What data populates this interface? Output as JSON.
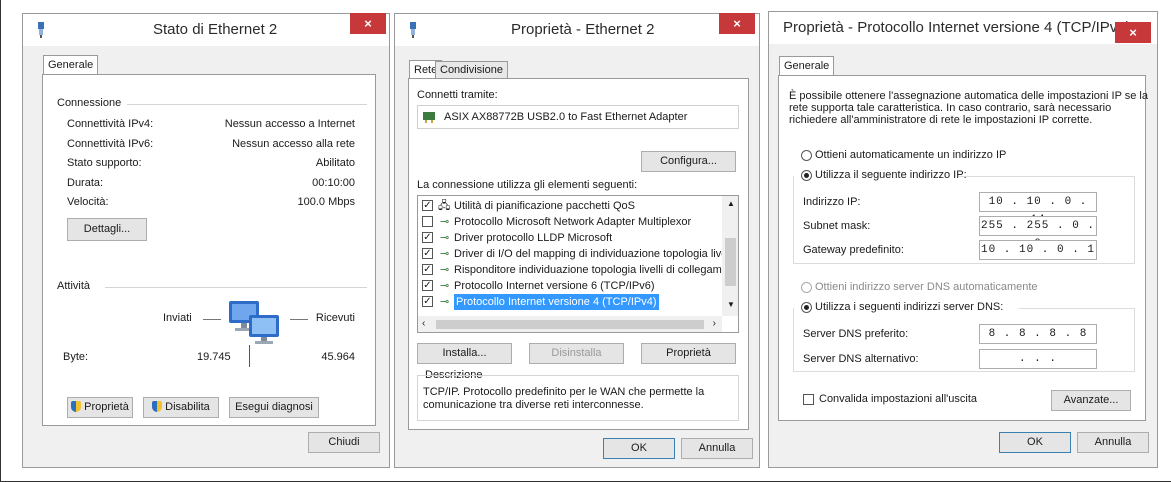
{
  "win1": {
    "title": "Stato di Ethernet 2",
    "close": "×",
    "tab": "Generale",
    "conn_header": "Connessione",
    "rows": [
      {
        "label": "Connettività IPv4:",
        "value": "Nessun accesso a Internet"
      },
      {
        "label": "Connettività IPv6:",
        "value": "Nessun accesso alla rete"
      },
      {
        "label": "Stato supporto:",
        "value": "Abilitato"
      },
      {
        "label": "Durata:",
        "value": "00:10:00"
      },
      {
        "label": "Velocità:",
        "value": "100.0 Mbps"
      }
    ],
    "details_btn": "Dettagli...",
    "activity_header": "Attività",
    "sent": "Inviati",
    "received": "Ricevuti",
    "bytes_label": "Byte:",
    "bytes_sent": "19.745",
    "bytes_received": "45.964",
    "props_btn": "Proprietà",
    "disable_btn": "Disabilita",
    "diag_btn": "Esegui diagnosi",
    "close_btn": "Chiudi"
  },
  "win2": {
    "title": "Proprietà - Ethernet 2",
    "close": "×",
    "tabs": [
      "Rete",
      "Condivisione"
    ],
    "connect_using": "Connetti tramite:",
    "adapter": "ASIX AX88772B USB2.0 to Fast Ethernet Adapter",
    "configure_btn": "Configura...",
    "items_label": "La connessione utilizza gli elementi seguenti:",
    "items": [
      {
        "checked": true,
        "label": "Utilità di pianificazione pacchetti QoS"
      },
      {
        "checked": false,
        "label": "Protocollo Microsoft Network Adapter Multiplexor"
      },
      {
        "checked": true,
        "label": "Driver protocollo LLDP Microsoft"
      },
      {
        "checked": true,
        "label": "Driver di I/O del mapping di individuazione topologia livelli c"
      },
      {
        "checked": true,
        "label": "Risponditore individuazione topologia livelli di collegamento"
      },
      {
        "checked": true,
        "label": "Protocollo Internet versione 6 (TCP/IPv6)"
      },
      {
        "checked": true,
        "label": "Protocollo Internet versione 4 (TCP/IPv4)"
      }
    ],
    "install_btn": "Installa...",
    "uninstall_btn": "Disinstalla",
    "props_btn": "Proprietà",
    "desc_header": "Descrizione",
    "desc_text_1": "TCP/IP. Protocollo predefinito per le WAN che permette la",
    "desc_text_2": "comunicazione tra diverse reti interconnesse.",
    "ok_btn": "OK",
    "cancel_btn": "Annulla"
  },
  "win3": {
    "title": "Proprietà - Protocollo Internet versione 4 (TCP/IPv4)",
    "close": "×",
    "tab": "Generale",
    "intro_1": "È possibile ottenere l'assegnazione automatica delle impostazioni IP se la",
    "intro_2": "rete supporta tale caratteristica. In caso contrario, sarà necessario",
    "intro_3": "richiedere all'amministratore di rete le impostazioni IP corrette.",
    "auto_ip": "Ottieni automaticamente un indirizzo IP",
    "manual_ip": "Utilizza il seguente indirizzo IP:",
    "ip_label": "Indirizzo IP:",
    "ip_value": "10 . 10 . 0 . 14",
    "mask_label": "Subnet mask:",
    "mask_value": "255 . 255 . 0 . 0",
    "gw_label": "Gateway predefinito:",
    "gw_value": "10 . 10 . 0 . 1",
    "auto_dns": "Ottieni indirizzo server DNS automaticamente",
    "manual_dns": "Utilizza i seguenti indirizzi server DNS:",
    "dns1_label": "Server DNS preferito:",
    "dns1_value": "8 . 8 . 8 . 8",
    "dns2_label": "Server DNS alternativo:",
    "dns2_value": ". . .",
    "validate": "Convalida impostazioni all'uscita",
    "advanced_btn": "Avanzate...",
    "ok_btn": "OK",
    "cancel_btn": "Annulla"
  }
}
